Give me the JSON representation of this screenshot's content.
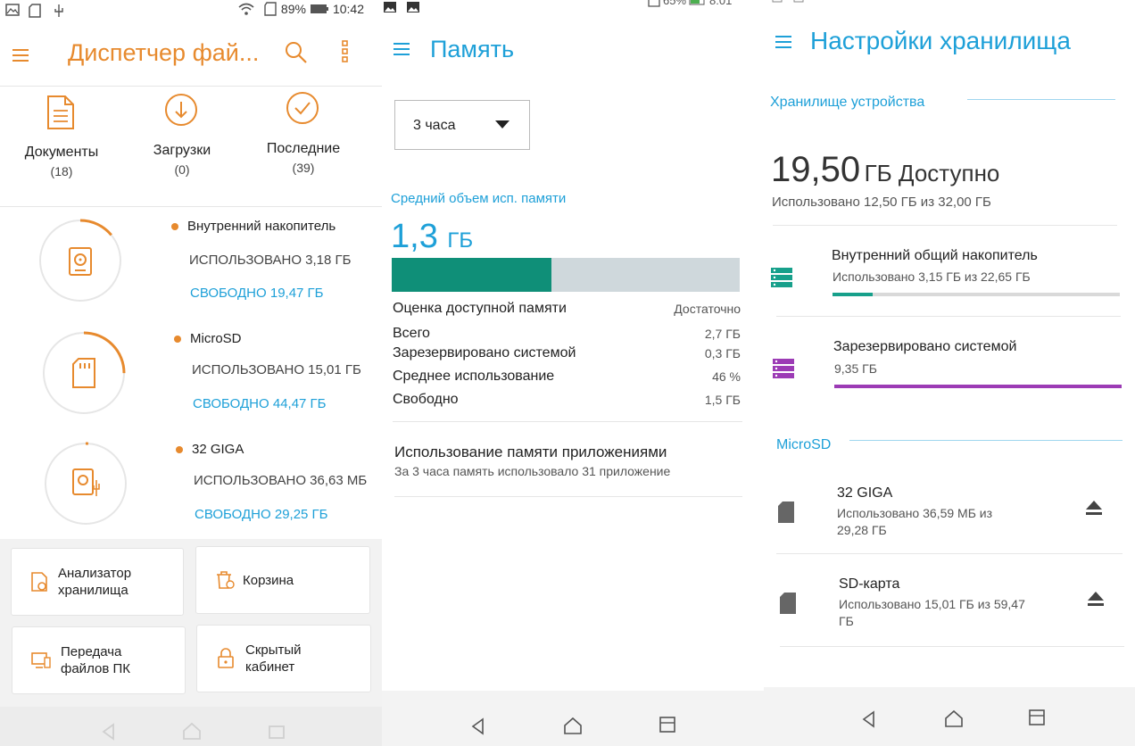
{
  "screen1": {
    "status": {
      "battery": "89%",
      "time": "10:42"
    },
    "title": "Диспетчер фай...",
    "categories": [
      {
        "label": "Документы",
        "count": "(18)"
      },
      {
        "label": "Загрузки",
        "count": "(0)"
      },
      {
        "label": "Последние",
        "count": "(39)"
      }
    ],
    "storages": [
      {
        "name": "Внутренний накопитель",
        "used": "ИСПОЛЬЗОВАНО 3,18 ГБ",
        "free": "СВОБОДНО 19,47 ГБ",
        "usage": 0.14
      },
      {
        "name": "MicroSD",
        "used": "ИСПОЛЬЗОВАНО 15,01 ГБ",
        "free": "СВОБОДНО 44,47 ГБ",
        "usage": 0.25
      },
      {
        "name": "32 GIGA",
        "used": "ИСПОЛЬЗОВАНО 36,63 МБ",
        "free": "СВОБОДНО 29,25 ГБ",
        "usage": 0.01
      }
    ],
    "tools": [
      {
        "label": "Анализатор хранилища"
      },
      {
        "label": "Корзина"
      },
      {
        "label": "Передача файлов ПК"
      },
      {
        "label": "Скрытый кабинет"
      }
    ],
    "accent": "#e78a2e",
    "link_color": "#1ea0d8"
  },
  "screen2": {
    "status": {
      "battery": "65%",
      "time": "8:01"
    },
    "title": "Память",
    "dropdown_value": "3 часа",
    "section_label": "Средний объем исп. памяти",
    "avg_value": "1,3",
    "avg_unit": "ГБ",
    "usage_fraction": 0.46,
    "rows": [
      {
        "label": "Оценка доступной памяти",
        "value": "Достаточно"
      },
      {
        "label": "Всего",
        "value": "2,7 ГБ"
      },
      {
        "label": "Зарезервировано системой",
        "value": "0,3 ГБ"
      },
      {
        "label": "Среднее использование",
        "value": "46 %"
      },
      {
        "label": "Свободно",
        "value": "1,5 ГБ"
      }
    ],
    "apps_title": "Использование памяти приложениями",
    "apps_subtitle": "За 3 часа память использовало 31 приложение",
    "bar_color": "#0f8f78"
  },
  "screen3": {
    "title": "Настройки хранилища",
    "device_section": "Хранилище устройства",
    "available_value": "19,50",
    "available_unit": "ГБ Доступно",
    "used_summary": "Использовано 12,50 ГБ из 32,00 ГБ",
    "device_items": [
      {
        "name": "Внутренний общий накопитель",
        "detail": "Использовано 3,15 ГБ из 22,65 ГБ",
        "usage": 0.14,
        "color": "#17a08b"
      },
      {
        "name": "Зарезервировано системой",
        "detail": "9,35 ГБ",
        "usage": 1.0,
        "color": "#9c3bb5"
      }
    ],
    "microsd_section": "MicroSD",
    "sd_items": [
      {
        "name": "32 GIGA",
        "detail": "Использовано 36,59 МБ из 29,28 ГБ"
      },
      {
        "name": "SD-карта",
        "detail": "Использовано 15,01 ГБ из 59,47 ГБ"
      }
    ]
  }
}
